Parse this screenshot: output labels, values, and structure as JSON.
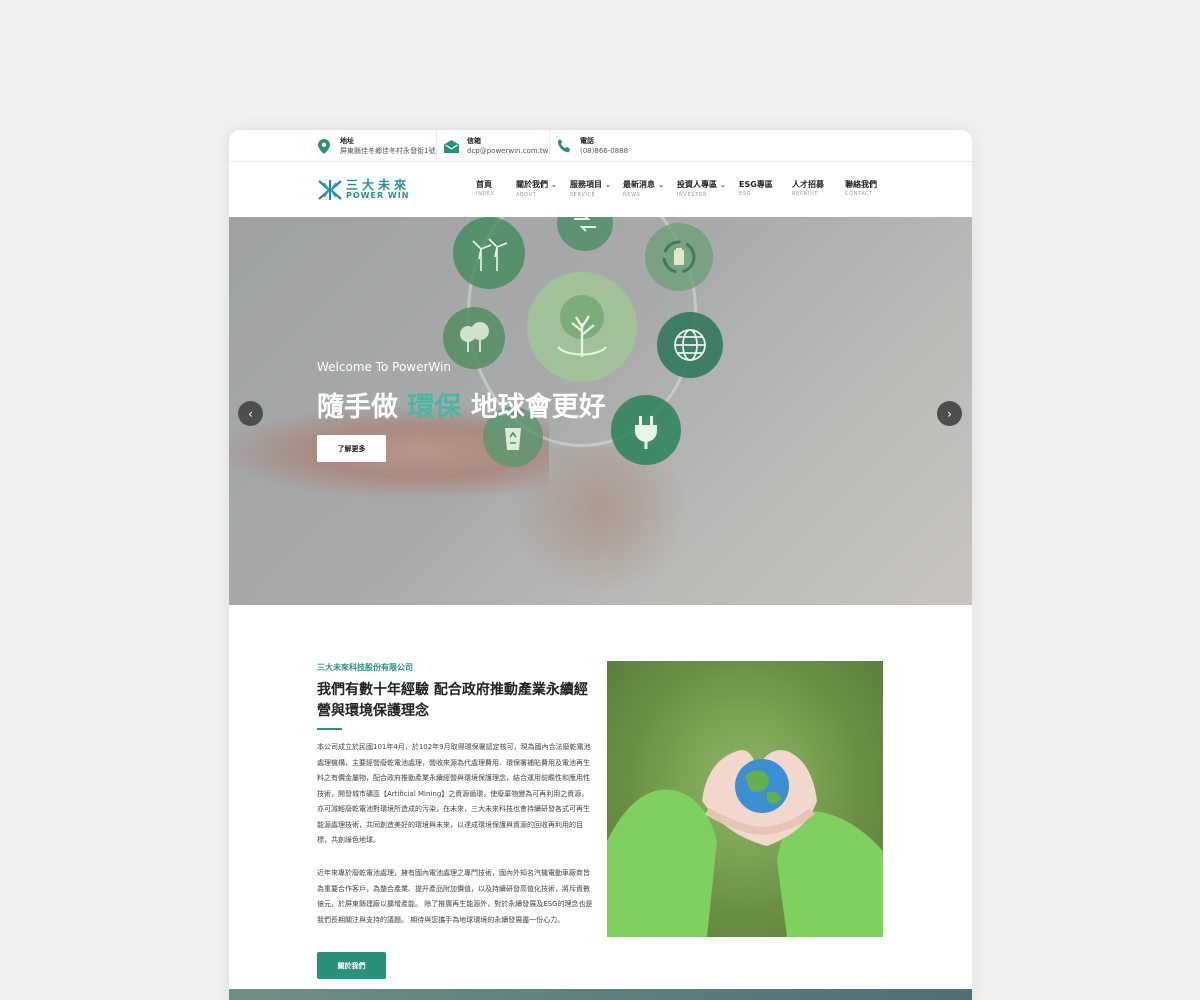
{
  "contact_bar": {
    "address": {
      "label": "地址",
      "value": "屏東縣佳冬鄉佳冬村永發街1號",
      "icon": "map-pin-icon"
    },
    "email": {
      "label": "信箱",
      "value": "dcp@powerwin.com.tw",
      "icon": "envelope-icon"
    },
    "phone": {
      "label": "電話",
      "value": "(08)866-0888",
      "icon": "phone-icon"
    }
  },
  "logo": {
    "cn": "三大未來",
    "en": "POWER WIN"
  },
  "nav": [
    {
      "cn": "首頁",
      "en": "INDEX",
      "dropdown": false
    },
    {
      "cn": "關於我們",
      "en": "ABOUT",
      "dropdown": true
    },
    {
      "cn": "服務項目",
      "en": "SERVICE",
      "dropdown": true
    },
    {
      "cn": "最新消息",
      "en": "NEWS",
      "dropdown": true
    },
    {
      "cn": "投資人專區",
      "en": "INVESTOR",
      "dropdown": true
    },
    {
      "cn": "ESG專區",
      "en": "ESG",
      "dropdown": false
    },
    {
      "cn": "人才招募",
      "en": "RECRUIT",
      "dropdown": false
    },
    {
      "cn": "聯絡我們",
      "en": "CONTACT",
      "dropdown": false
    }
  ],
  "hero": {
    "welcome": "Welcome To PowerWin",
    "title_before": "隨手做",
    "title_accent": "環保",
    "title_after": "地球會更好",
    "button": "了解更多",
    "prev": "‹",
    "next": "›"
  },
  "about": {
    "kicker": "三大未來科技股份有限公司",
    "title": "我們有數十年經驗 配合政府推動產業永續經營與環境保護理念",
    "paragraph1": "本公司成立於民國101年4月，於102年9月取得環保署認定核可，現為國內合法廢乾電池處理機構，主要經營廢乾電池處理，營收來源為代處理費用、環保署補貼費用及電池再生料之有價金屬物，配合政府推動產業永續經營與環境保護理念，結合運用前瞻性和應用性技術，開發城市礦區【Artificial Mining】之資源循環，使廢棄物變為可再利用之資源，亦可減輕廢乾電池對環境所造成的污染，在未來，三大未來科技也會持續研發各式可再生能源處理技術，共同創造美好的環境與未來，以達成環境保護與資源的回收再利用的目標，共創綠色地球。",
    "paragraph2": "近年來專於廢乾電池處理，擁有國內電池處理之專門技術，國內外知名汽機電動車廠商皆為重要合作客戶，為整合產業、提升產品附加價值，以及持續研發高值化技術，將斥資數億元，於屏東縣建廠以擴增產能。 除了推廣再生能源外，對於永續發展及ESG的理念也是我們長期關注與支持的議題。 期待與您攜手為地球環境的永續發展盡一份心力。",
    "button": "關於我們"
  },
  "colors": {
    "accent": "#2b8f7c",
    "hero_accent": "#4db6a3"
  }
}
